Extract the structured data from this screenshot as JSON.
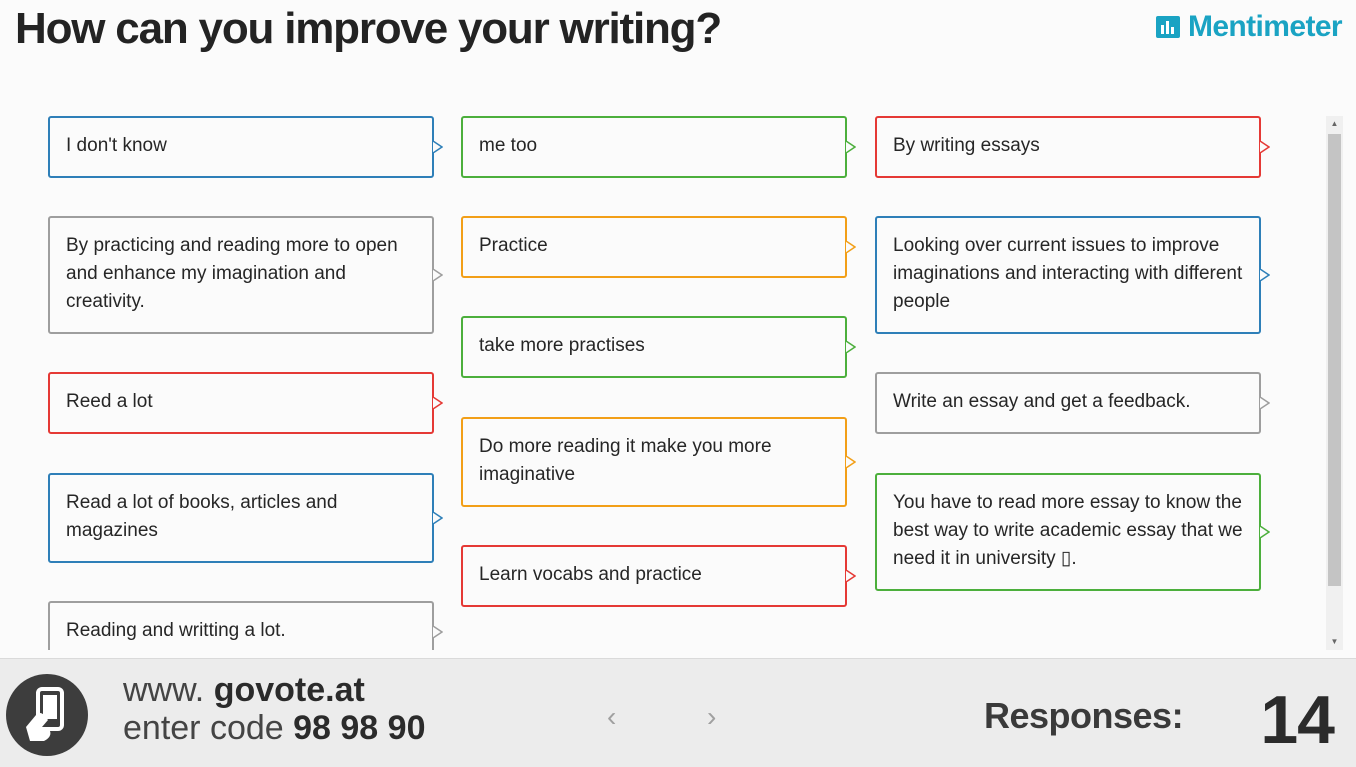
{
  "header": {
    "title": "How can you improve your writing?",
    "brand": "Mentimeter",
    "brand_color": "#1aa3c3"
  },
  "responses": [
    {
      "text": "I don't know",
      "color": "blue"
    },
    {
      "text": "By practicing and reading more to open and enhance my imagination and creativity.",
      "color": "gray"
    },
    {
      "text": "Reed a lot",
      "color": "red"
    },
    {
      "text": "Read a lot of books, articles and magazines",
      "color": "blue"
    },
    {
      "text": "Reading and writting a lot.",
      "color": "gray"
    },
    {
      "text": "me too",
      "color": "green"
    },
    {
      "text": "Practice",
      "color": "orange"
    },
    {
      "text": "take more practises",
      "color": "green"
    },
    {
      "text": "Do more reading it make you more imaginative",
      "color": "orange"
    },
    {
      "text": "Learn vocabs and practice",
      "color": "red"
    },
    {
      "text": "By writing essays",
      "color": "red"
    },
    {
      "text": "Looking over current issues to improve imaginations and interacting with different people",
      "color": "blue"
    },
    {
      "text": "Write an essay and get a feedback.",
      "color": "gray"
    },
    {
      "text": "You have to read more essay to know the best way to write academic essay that we need it in university ▯.",
      "color": "green"
    }
  ],
  "colors": {
    "blue": "#2e7fb8",
    "green": "#4caf3c",
    "red": "#e53935",
    "gray": "#9e9e9e",
    "orange": "#f29f18"
  },
  "footer": {
    "url_prefix": "www. ",
    "url": "govote.at",
    "code_prefix": "enter code ",
    "code": "98 98 90",
    "prev_icon": "chevron-left-icon",
    "next_icon": "chevron-right-icon",
    "responses_label": "Responses:",
    "responses_count": "14"
  }
}
